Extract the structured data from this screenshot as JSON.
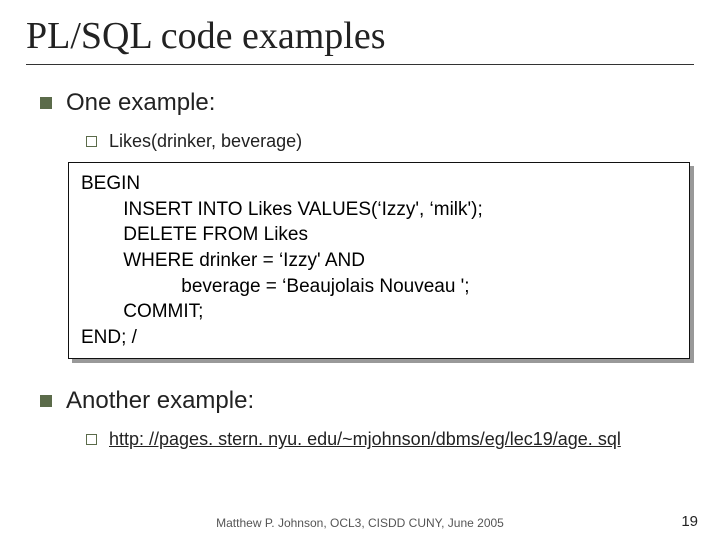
{
  "title": "PL/SQL code examples",
  "bullets": {
    "first": "One example:",
    "firstSub": "Likes(drinker, beverage)",
    "second": "Another example:",
    "secondLink": "http: //pages. stern. nyu. edu/~mjohnson/dbms/eg/lec19/age. sql"
  },
  "code": {
    "l1": "BEGIN",
    "l2": "        INSERT INTO Likes VALUES(‘Izzy', ‘milk');",
    "l3": "        DELETE FROM Likes",
    "l4": "        WHERE drinker = ‘Izzy' AND",
    "l5": "                   beverage = ‘Beaujolais Nouveau ';",
    "l6": "        COMMIT;",
    "l7": "END; /"
  },
  "footer": "Matthew P. Johnson, OCL3, CISDD CUNY, June 2005",
  "page": "19"
}
